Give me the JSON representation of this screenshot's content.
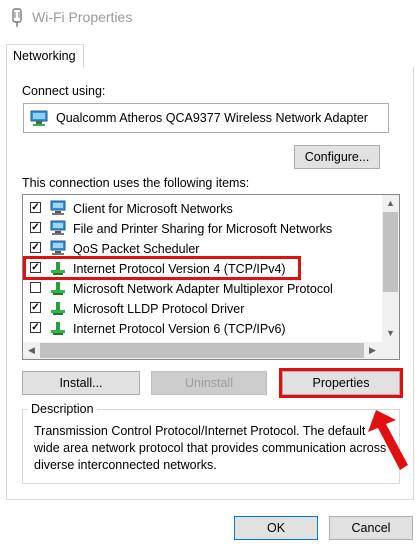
{
  "window": {
    "title": "Wi-Fi Properties"
  },
  "tabs": [
    {
      "label": "Networking"
    }
  ],
  "connect_using": {
    "label": "Connect using:",
    "adapter_name": "Qualcomm Atheros QCA9377 Wireless Network Adapter"
  },
  "configure_button": "Configure...",
  "items_label": "This connection uses the following items:",
  "items": [
    {
      "label": "Client for Microsoft Networks",
      "checked": true,
      "icon": "network-client-icon"
    },
    {
      "label": "File and Printer Sharing for Microsoft Networks",
      "checked": true,
      "icon": "file-printer-sharing-icon"
    },
    {
      "label": "QoS Packet Scheduler",
      "checked": true,
      "icon": "qos-scheduler-icon"
    },
    {
      "label": "Internet Protocol Version 4 (TCP/IPv4)",
      "checked": true,
      "icon": "protocol-icon"
    },
    {
      "label": "Microsoft Network Adapter Multiplexor Protocol",
      "checked": false,
      "icon": "protocol-icon"
    },
    {
      "label": "Microsoft LLDP Protocol Driver",
      "checked": true,
      "icon": "protocol-icon"
    },
    {
      "label": "Internet Protocol Version 6 (TCP/IPv6)",
      "checked": true,
      "icon": "protocol-icon"
    }
  ],
  "buttons": {
    "install": "Install...",
    "uninstall": "Uninstall",
    "properties": "Properties",
    "ok": "OK",
    "cancel": "Cancel"
  },
  "description": {
    "title": "Description",
    "text": "Transmission Control Protocol/Internet Protocol. The default wide area network protocol that provides communication across diverse interconnected networks."
  },
  "colors": {
    "highlight": "#e01010",
    "accent": "#0078d7"
  }
}
